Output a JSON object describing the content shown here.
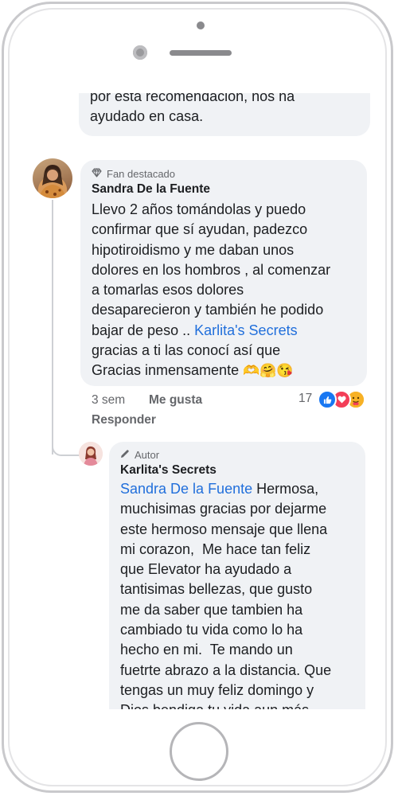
{
  "previous_comment": {
    "lines": [
      "por esta recomendacion, nos ha",
      "ayudado en casa."
    ]
  },
  "comment": {
    "badge": "Fan destacado",
    "author": "Sandra De la Fuente",
    "lines": [
      "Llevo 2 años tomándolas y puedo",
      "confirmar que sí ayudan, padezco",
      "hipotiroidismo y me daban unos",
      "dolores en los hombros , al comenzar",
      "a tomarlas esos dolores",
      "desaparecieron y también he podido",
      "bajar de peso .. ",
      "gracias a ti las conocí así que",
      "Gracias inmensamente "
    ],
    "mention": "Karlita's Secrets",
    "emoji": "🫶🤗😘",
    "time": "3 sem",
    "like": "Me gusta",
    "reply": "Responder",
    "reaction_count": "17",
    "reaction_colors": {
      "like": "#1877f2",
      "love": "#f33e58",
      "care": "#f7b125"
    }
  },
  "reply": {
    "badge": "Autor",
    "author": "Karlita's Secrets",
    "mention": "Sandra De la Fuente",
    "first_line_rest": " Hermosa,",
    "lines": [
      "muchisimas gracias por dejarme",
      "este hermoso mensaje que llena",
      "mi corazon,  Me hace tan feliz",
      "que Elevator ha ayudado a",
      "tantisimas bellezas, que gusto",
      "me da saber que tambien ha",
      "cambiado tu vida como lo ha",
      "hecho en mi.  Te mando un",
      "fuetrte abrazo a la distancia. Que",
      "tengas un muy feliz domingo y",
      "Dios bendiga tu vida aun más."
    ]
  }
}
